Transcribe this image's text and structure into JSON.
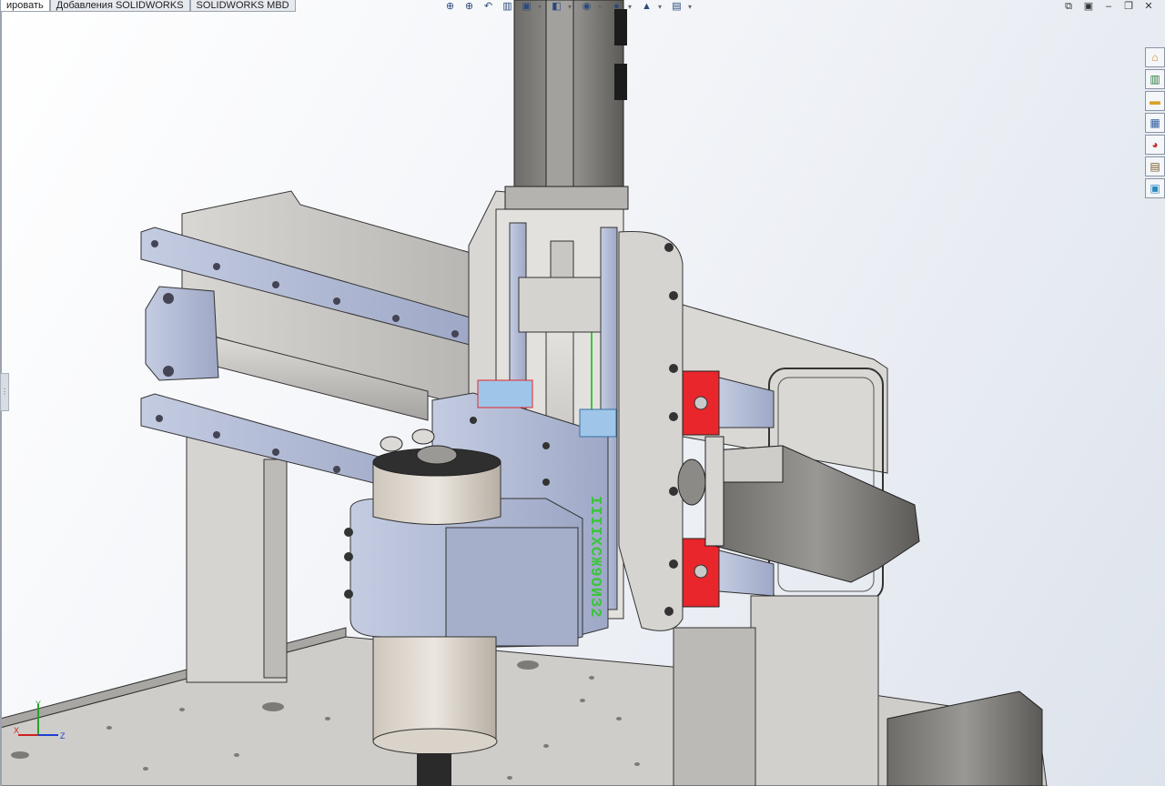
{
  "tabs": [
    {
      "label": "ировать",
      "active": true
    },
    {
      "label": "Добавления SOLIDWORKS",
      "active": false
    },
    {
      "label": "SOLIDWORKS MBD",
      "active": false
    }
  ],
  "hud_icons": [
    "zoom-to-fit-icon",
    "zoom-area-icon",
    "previous-view-icon",
    "section-view-icon",
    "view-orientation-icon",
    "display-style-icon",
    "hide-show-icon",
    "edit-appearance-icon",
    "apply-scene-icon",
    "view-settings-icon"
  ],
  "window_controls": {
    "tile": "⧉",
    "restore": "▣",
    "minimize": "–",
    "maximize": "❐",
    "close": "✕"
  },
  "task_pane": [
    "home-icon",
    "design-library-icon",
    "file-explorer-icon",
    "view-palette-icon",
    "appearances-icon",
    "custom-properties-icon",
    "forum-icon"
  ],
  "triad": {
    "x": "X",
    "y": "Y",
    "z": "Z"
  },
  "model_label": "IIIIXCЖ9ОИЗ2",
  "colors": {
    "rail": "#b8bfd6",
    "gray": "#c8c6c2",
    "red": "#e8262b",
    "green": "#3cc43c",
    "blue": "#9fc6e8"
  }
}
